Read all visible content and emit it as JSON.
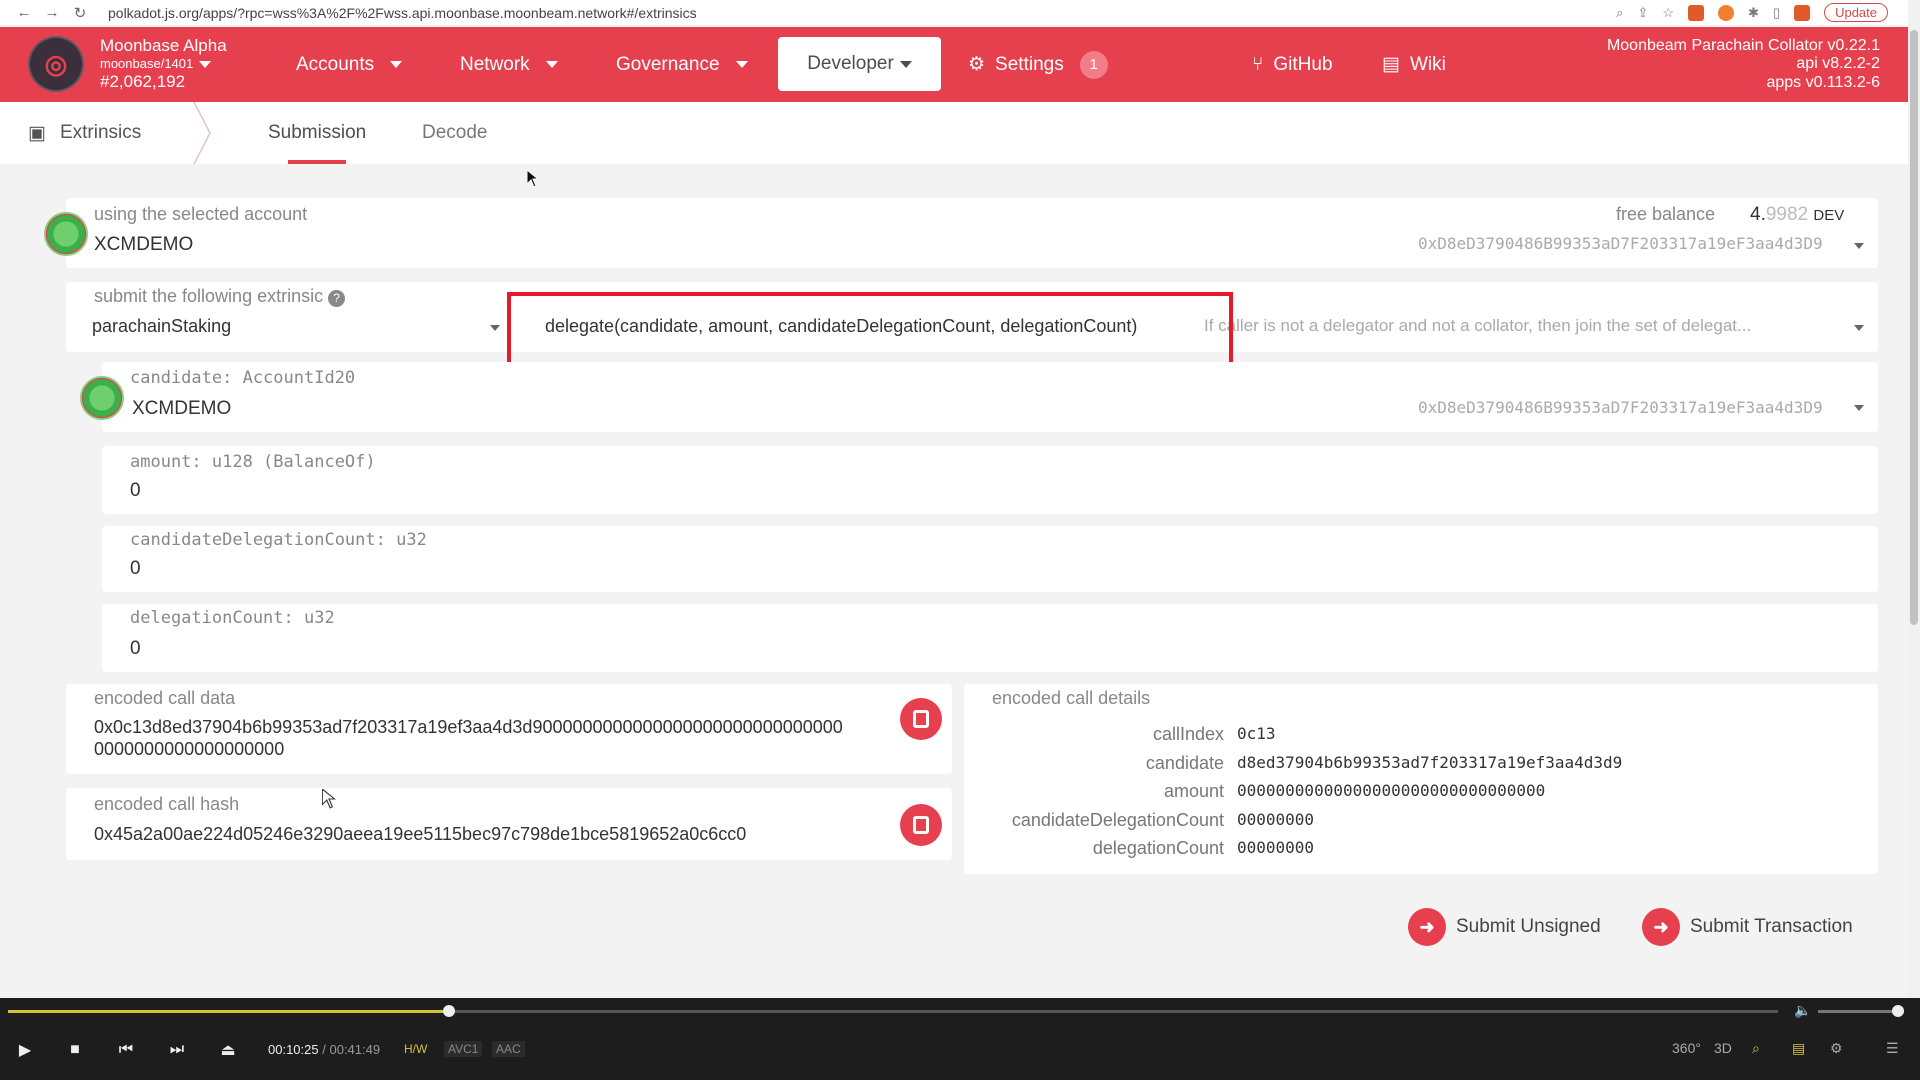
{
  "browser": {
    "url": "polkadot.js.org/apps/?rpc=wss%3A%2F%2Fwss.api.moonbase.moonbeam.network#/extrinsics",
    "update_label": "Update"
  },
  "topnav": {
    "chain_name": "Moonbase Alpha",
    "chain_sub": "moonbase/1401",
    "block": "#2,062,192",
    "accounts": "Accounts",
    "network": "Network",
    "governance": "Governance",
    "developer": "Developer",
    "settings": "Settings",
    "settings_badge": "1",
    "github": "GitHub",
    "wiki": "Wiki",
    "version_line1": "Moonbeam Parachain Collator v0.22.1",
    "version_line2": "api v8.2.2-2",
    "version_line3": "apps v0.113.2-6",
    "accent": "#e6404f"
  },
  "subnav": {
    "section": "Extrinsics",
    "tab_submission": "Submission",
    "tab_decode": "Decode"
  },
  "account": {
    "label": "using the selected account",
    "name": "XCMDEMO",
    "free_balance_label": "free balance",
    "balance_int": "4.",
    "balance_dec": "9982",
    "balance_unit": "DEV",
    "address": "0xD8eD3790486B99353aD7F203317a19eF3aa4d3D9"
  },
  "extrinsic": {
    "label": "submit the following extrinsic",
    "pallet": "parachainStaking",
    "call": "delegate(candidate, amount, candidateDelegationCount, delegationCount)",
    "description": "If caller is not a delegator and not a collator, then join the set of delegat..."
  },
  "params": {
    "candidate_label": "candidate: AccountId20",
    "candidate_name": "XCMDEMO",
    "candidate_address": "0xD8eD3790486B99353aD7F203317a19eF3aa4d3D9",
    "amount_label": "amount: u128 (BalanceOf)",
    "amount_value": "0",
    "cdc_label": "candidateDelegationCount: u32",
    "cdc_value": "0",
    "dc_label": "delegationCount: u32",
    "dc_value": "0"
  },
  "encoded": {
    "call_data_label": "encoded call data",
    "call_data_line1": "0x0c13d8ed37904b6b99353ad7f203317a19ef3aa4d3d9000000000000000000000000000000",
    "call_data_line2": "0000000000000000000",
    "call_hash_label": "encoded call hash",
    "call_hash": "0x45a2a00ae224d05246e3290aeea19ee5115bec97c798de1bce5819652a0c6cc0",
    "details_label": "encoded call details",
    "details": [
      {
        "key": "callIndex",
        "value": "0c13"
      },
      {
        "key": "candidate",
        "value": "d8ed37904b6b99353ad7f203317a19ef3aa4d3d9"
      },
      {
        "key": "amount",
        "value": "00000000000000000000000000000000"
      },
      {
        "key": "candidateDelegationCount",
        "value": "00000000"
      },
      {
        "key": "delegationCount",
        "value": "00000000"
      }
    ]
  },
  "actions": {
    "submit_unsigned": "Submit Unsigned",
    "submit_transaction": "Submit Transaction"
  },
  "player": {
    "time_current": "00:10:25",
    "time_sep": "/",
    "time_total": "00:41:49",
    "tag_hw": "H/W",
    "tag_video": "AVC1",
    "tag_audio": "AAC",
    "label_360": "360°",
    "label_3d": "3D",
    "progress": 0.249,
    "volume": 1.0
  }
}
